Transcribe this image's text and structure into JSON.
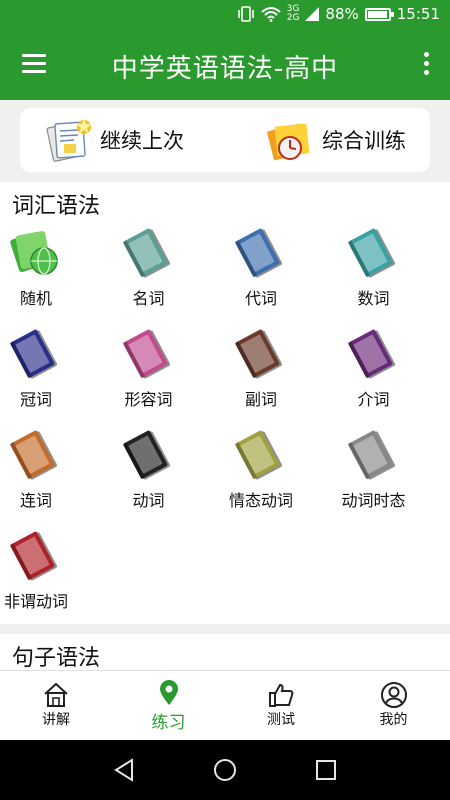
{
  "status": {
    "battery": "88%",
    "time": "15:51",
    "net1": "3G",
    "net2": "2G",
    "battery_level": 0.88
  },
  "appbar": {
    "title": "中学英语语法-高中"
  },
  "quick": {
    "continue_label": "继续上次",
    "training_label": "综合训练"
  },
  "sections": [
    {
      "title": "词汇语法",
      "items": [
        {
          "label": "随机",
          "icon": "random-icon",
          "color": "#3fae3a"
        },
        {
          "label": "名词",
          "icon": "book-icon",
          "color": "#5a9f94"
        },
        {
          "label": "代词",
          "icon": "book-icon",
          "color": "#3c6fae"
        },
        {
          "label": "数词",
          "icon": "book-icon",
          "color": "#3aa0a4"
        },
        {
          "label": "冠词",
          "icon": "book-icon",
          "color": "#2a2f8a"
        },
        {
          "label": "形容词",
          "icon": "book-icon",
          "color": "#c04a8c"
        },
        {
          "label": "副词",
          "icon": "book-icon",
          "color": "#6b3a2a"
        },
        {
          "label": "介词",
          "icon": "book-icon",
          "color": "#6a2a7a"
        },
        {
          "label": "连词",
          "icon": "book-icon",
          "color": "#c46a2a"
        },
        {
          "label": "动词",
          "icon": "book-icon",
          "color": "#222222"
        },
        {
          "label": "情态动词",
          "icon": "book-icon",
          "color": "#a0a040"
        },
        {
          "label": "动词时态",
          "icon": "book-icon",
          "color": "#888888"
        },
        {
          "label": "非谓动词",
          "icon": "book-icon",
          "color": "#b0222a"
        }
      ]
    },
    {
      "title": "句子语法"
    }
  ],
  "bottomnav": {
    "tabs": [
      {
        "label": "讲解",
        "icon": "home-icon"
      },
      {
        "label": "练习",
        "icon": "location-pin-icon"
      },
      {
        "label": "测试",
        "icon": "thumbs-up-icon"
      },
      {
        "label": "我的",
        "icon": "user-icon"
      }
    ],
    "active_index": 1
  },
  "colors": {
    "primary": "#2a9a2f",
    "background": "#f0f0f0"
  }
}
